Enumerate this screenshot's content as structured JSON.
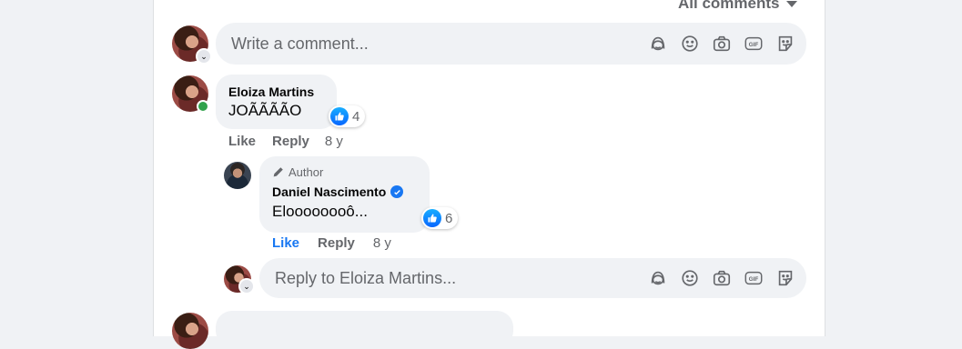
{
  "header": {
    "filter_label": "All comments"
  },
  "composer": {
    "placeholder": "Write a comment..."
  },
  "comment": {
    "author": "Eloiza Martins",
    "text": "JOÃÃÃÃO",
    "reaction_count": "4",
    "like_label": "Like",
    "reply_label": "Reply",
    "time": "8 y"
  },
  "reply": {
    "badge": "Author",
    "author": "Daniel Nascimento",
    "text": "Eloooooooô...",
    "reaction_count": "6",
    "like_label": "Like",
    "reply_label": "Reply",
    "time": "8 y"
  },
  "reply_composer": {
    "placeholder": "Reply to Eloiza Martins..."
  },
  "colors": {
    "accent": "#1877f2",
    "bubble": "#f0f2f5",
    "online": "#31a24c"
  },
  "composer_icons": [
    "avatar-sticker-icon",
    "emoji-icon",
    "camera-icon",
    "gif-icon",
    "sticker-icon"
  ]
}
